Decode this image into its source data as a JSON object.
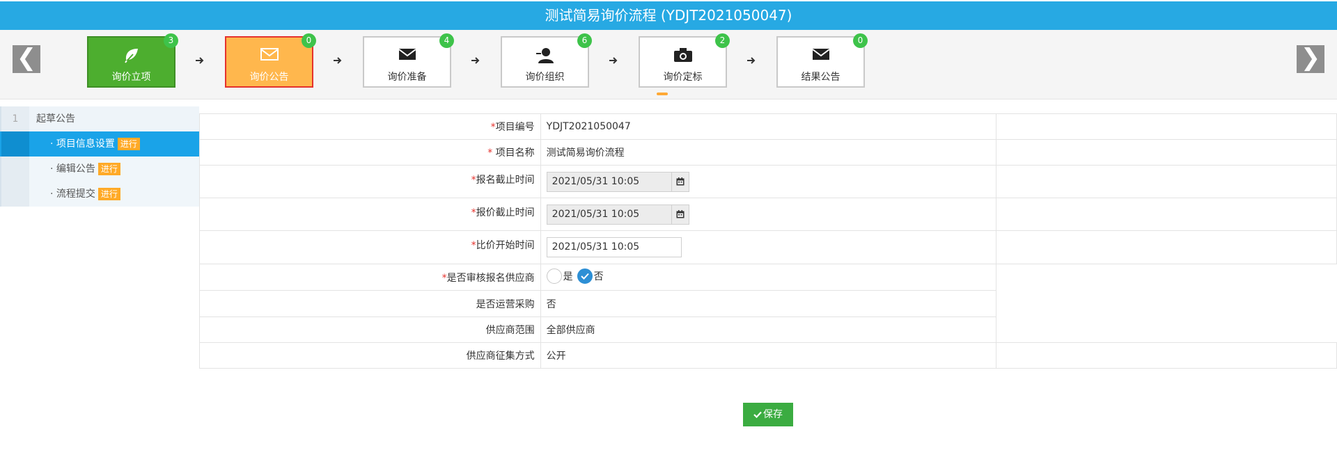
{
  "header": {
    "title": "测试简易询价流程 (YDJT2021050047)"
  },
  "steps": [
    {
      "label": "询价立项",
      "badge": "3",
      "icon": "leaf-icon",
      "state": "done"
    },
    {
      "label": "询价公告",
      "badge": "0",
      "icon": "envelope-icon",
      "state": "active"
    },
    {
      "label": "询价准备",
      "badge": "4",
      "icon": "envelope-icon",
      "state": "normal"
    },
    {
      "label": "询价组织",
      "badge": "6",
      "icon": "user-icon",
      "state": "normal"
    },
    {
      "label": "询价定标",
      "badge": "2",
      "icon": "camera-icon",
      "state": "normal"
    },
    {
      "label": "结果公告",
      "badge": "0",
      "icon": "envelope-icon",
      "state": "normal"
    }
  ],
  "nav": {
    "prev": "❮",
    "next": "❯"
  },
  "sidebar": {
    "group": {
      "num": "1",
      "label": "起草公告"
    },
    "items": [
      {
        "label": "· 项目信息设置",
        "tag": "进行",
        "selected": true
      },
      {
        "label": "· 编辑公告",
        "tag": "进行",
        "selected": false
      },
      {
        "label": "· 流程提交",
        "tag": "进行",
        "selected": false
      }
    ]
  },
  "form": {
    "project_no": {
      "req": "*",
      "label": "项目编号",
      "value": "YDJT2021050047"
    },
    "project_name": {
      "req": "* ",
      "label": "项目名称",
      "value": "测试简易询价流程"
    },
    "signup_deadline": {
      "req": "*",
      "label": "报名截止时间",
      "value": "2021/05/31 10:05"
    },
    "quote_deadline": {
      "req": "*",
      "label": "报价截止时间",
      "value": "2021/05/31 10:05"
    },
    "compare_start": {
      "req": "*",
      "label": "比价开始时间",
      "value": "2021/05/31 10:05"
    },
    "review_supplier": {
      "req": "*",
      "label": "是否审核报名供应商",
      "yes": "是",
      "no": "否",
      "selected": "否"
    },
    "ops_purchase": {
      "label": "是否运营采购",
      "value": "否"
    },
    "supplier_scope": {
      "label": "供应商范围",
      "value": "全部供应商"
    },
    "supplier_collect": {
      "label": "供应商征集方式",
      "value": "公开"
    }
  },
  "actions": {
    "save": "保存"
  },
  "colors": {
    "header": "#27a9e3",
    "done": "#4dae2f",
    "active": "#ffb74d",
    "badge": "#3ec34a",
    "selected": "#1aa3e8",
    "tag": "#ffaa27",
    "save": "#3bac41"
  }
}
